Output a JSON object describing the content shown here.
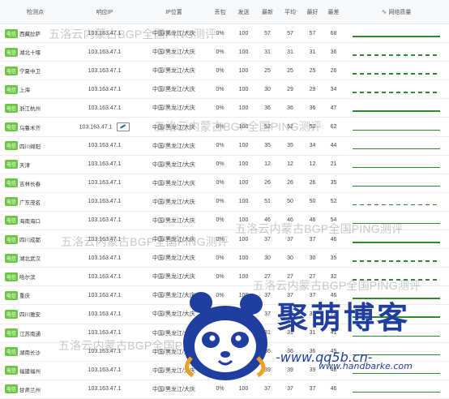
{
  "table": {
    "headers": {
      "point": "检测点",
      "ip": "响应IP",
      "location": "IP位置",
      "loss": "丢包",
      "sent": "发送",
      "latest": "最新",
      "avg": "平均",
      "best": "最好",
      "worst": "最差",
      "quality": "网络质量"
    },
    "rows": [
      {
        "isp": "电信",
        "city": "西藏拉萨",
        "ip": "103.163.47.1",
        "loc": "中国/黑龙江/大庆",
        "loss": "0%",
        "sent": "100",
        "latest": "57",
        "avg": "57",
        "best": "57",
        "worst": "68",
        "dotted": false
      },
      {
        "isp": "电信",
        "city": "湖北十堰",
        "ip": "103.163.47.1",
        "loc": "中国/黑龙江/大庆",
        "loss": "0%",
        "sent": "100",
        "latest": "31",
        "avg": "31",
        "best": "31",
        "worst": "36",
        "dotted": true
      },
      {
        "isp": "电信",
        "city": "宁夏中卫",
        "ip": "103.163.47.1",
        "loc": "中国/黑龙江/大庆",
        "loss": "0%",
        "sent": "100",
        "latest": "25",
        "avg": "25",
        "best": "25",
        "worst": "26",
        "dotted": true
      },
      {
        "isp": "电信",
        "city": "上海",
        "ip": "103.163.47.1",
        "loc": "中国/黑龙江/大庆",
        "loss": "0%",
        "sent": "100",
        "latest": "30",
        "avg": "29",
        "best": "29",
        "worst": "34",
        "dotted": true
      },
      {
        "isp": "电信",
        "city": "浙江杭州",
        "ip": "103.163.47.1",
        "loc": "中国/黑龙江/大庆",
        "loss": "0%",
        "sent": "100",
        "latest": "36",
        "avg": "36",
        "best": "36",
        "worst": "47",
        "dotted": false
      },
      {
        "isp": "电信",
        "city": "乌鲁木齐",
        "ip": "103.163.47.1",
        "loc": "中国/黑龙江/大庆",
        "loss": "0%",
        "sent": "100",
        "latest": "52",
        "avg": "52",
        "best": "52",
        "worst": "62",
        "dotted": false,
        "tool": true
      },
      {
        "isp": "电信",
        "city": "四川绵阳",
        "ip": "103.163.47.1",
        "loc": "中国/黑龙江/大庆",
        "loss": "0%",
        "sent": "100",
        "latest": "35",
        "avg": "35",
        "best": "34",
        "worst": "44",
        "dotted": false
      },
      {
        "isp": "电信",
        "city": "天津",
        "ip": "103.163.47.1",
        "loc": "中国/黑龙江/大庆",
        "loss": "0%",
        "sent": "100",
        "latest": "12",
        "avg": "12",
        "best": "12",
        "worst": "21",
        "dotted": false
      },
      {
        "isp": "电信",
        "city": "吉林长春",
        "ip": "103.163.47.1",
        "loc": "中国/黑龙江/大庆",
        "loss": "0%",
        "sent": "100",
        "latest": "26",
        "avg": "26",
        "best": "26",
        "worst": "35",
        "dotted": false
      },
      {
        "isp": "电信",
        "city": "广东茂名",
        "ip": "103.163.47.1",
        "loc": "中国/黑龙江/大庆",
        "loss": "0%",
        "sent": "100",
        "latest": "51",
        "avg": "50",
        "best": "50",
        "worst": "52",
        "dotted": true
      },
      {
        "isp": "电信",
        "city": "海南海口",
        "ip": "103.163.47.1",
        "loc": "中国/黑龙江/大庆",
        "loss": "0%",
        "sent": "100",
        "latest": "46",
        "avg": "46",
        "best": "46",
        "worst": "54",
        "dotted": false
      },
      {
        "isp": "电信",
        "city": "四川成都",
        "ip": "103.163.47.1",
        "loc": "中国/黑龙江/大庆",
        "loss": "0%",
        "sent": "100",
        "latest": "37",
        "avg": "37",
        "best": "37",
        "worst": "46",
        "dotted": false
      },
      {
        "isp": "电信",
        "city": "湖北武汉",
        "ip": "103.163.47.1",
        "loc": "中国/黑龙江/大庆",
        "loss": "0%",
        "sent": "100",
        "latest": "30",
        "avg": "30",
        "best": "30",
        "worst": "35",
        "dotted": true
      },
      {
        "isp": "电信",
        "city": "哈尔滨",
        "ip": "103.163.47.1",
        "loc": "中国/黑龙江/大庆",
        "loss": "0%",
        "sent": "100",
        "latest": "27",
        "avg": "27",
        "best": "27",
        "worst": "32",
        "dotted": true
      },
      {
        "isp": "电信",
        "city": "重庆",
        "ip": "103.163.47.1",
        "loc": "中国/黑龙江/大庆",
        "loss": "0%",
        "sent": "100",
        "latest": "37",
        "avg": "37",
        "best": "37",
        "worst": "46",
        "dotted": false
      },
      {
        "isp": "电信",
        "city": "四川雅安",
        "ip": "103.163.47.1",
        "loc": "中国/黑龙江/大庆",
        "loss": "0%",
        "sent": "100",
        "latest": "37",
        "avg": "37",
        "best": "37",
        "worst": "72",
        "dotted": false
      },
      {
        "isp": "电信",
        "city": "江苏南通",
        "ip": "103.163.47.1",
        "loc": "中国/黑龙江/大庆",
        "loss": "0%",
        "sent": "100",
        "latest": "31",
        "avg": "31",
        "best": "31",
        "worst": "41",
        "dotted": false
      },
      {
        "isp": "电信",
        "city": "湖南长沙",
        "ip": "103.163.47.1",
        "loc": "中国/黑龙江/大庆",
        "loss": "0%",
        "sent": "100",
        "latest": "36",
        "avg": "36",
        "best": "36",
        "worst": "45",
        "dotted": false
      },
      {
        "isp": "电信",
        "city": "福建福州",
        "ip": "103.163.47.1",
        "loc": "中国/黑龙江/大庆",
        "loss": "0%",
        "sent": "100",
        "latest": "39",
        "avg": "39",
        "best": "39",
        "worst": "48",
        "dotted": false
      },
      {
        "isp": "电信",
        "city": "甘肃兰州",
        "ip": "103.163.47.1",
        "loc": "中国/黑龙江/大庆",
        "loss": "0%",
        "sent": "100",
        "latest": "37",
        "avg": "37",
        "best": "37",
        "worst": "46",
        "dotted": false
      }
    ]
  },
  "watermark_text": "五洛云内蒙古BGP全国PING测评",
  "logo": {
    "title": "聚萌博客",
    "url": "-www.qq5b.cn-",
    "small_url": "www.handbarke.com",
    "brand_color": "#1f3ea0"
  },
  "colors": {
    "isp_badge": "#6cc644",
    "quality_line": "#2e8b2e"
  }
}
